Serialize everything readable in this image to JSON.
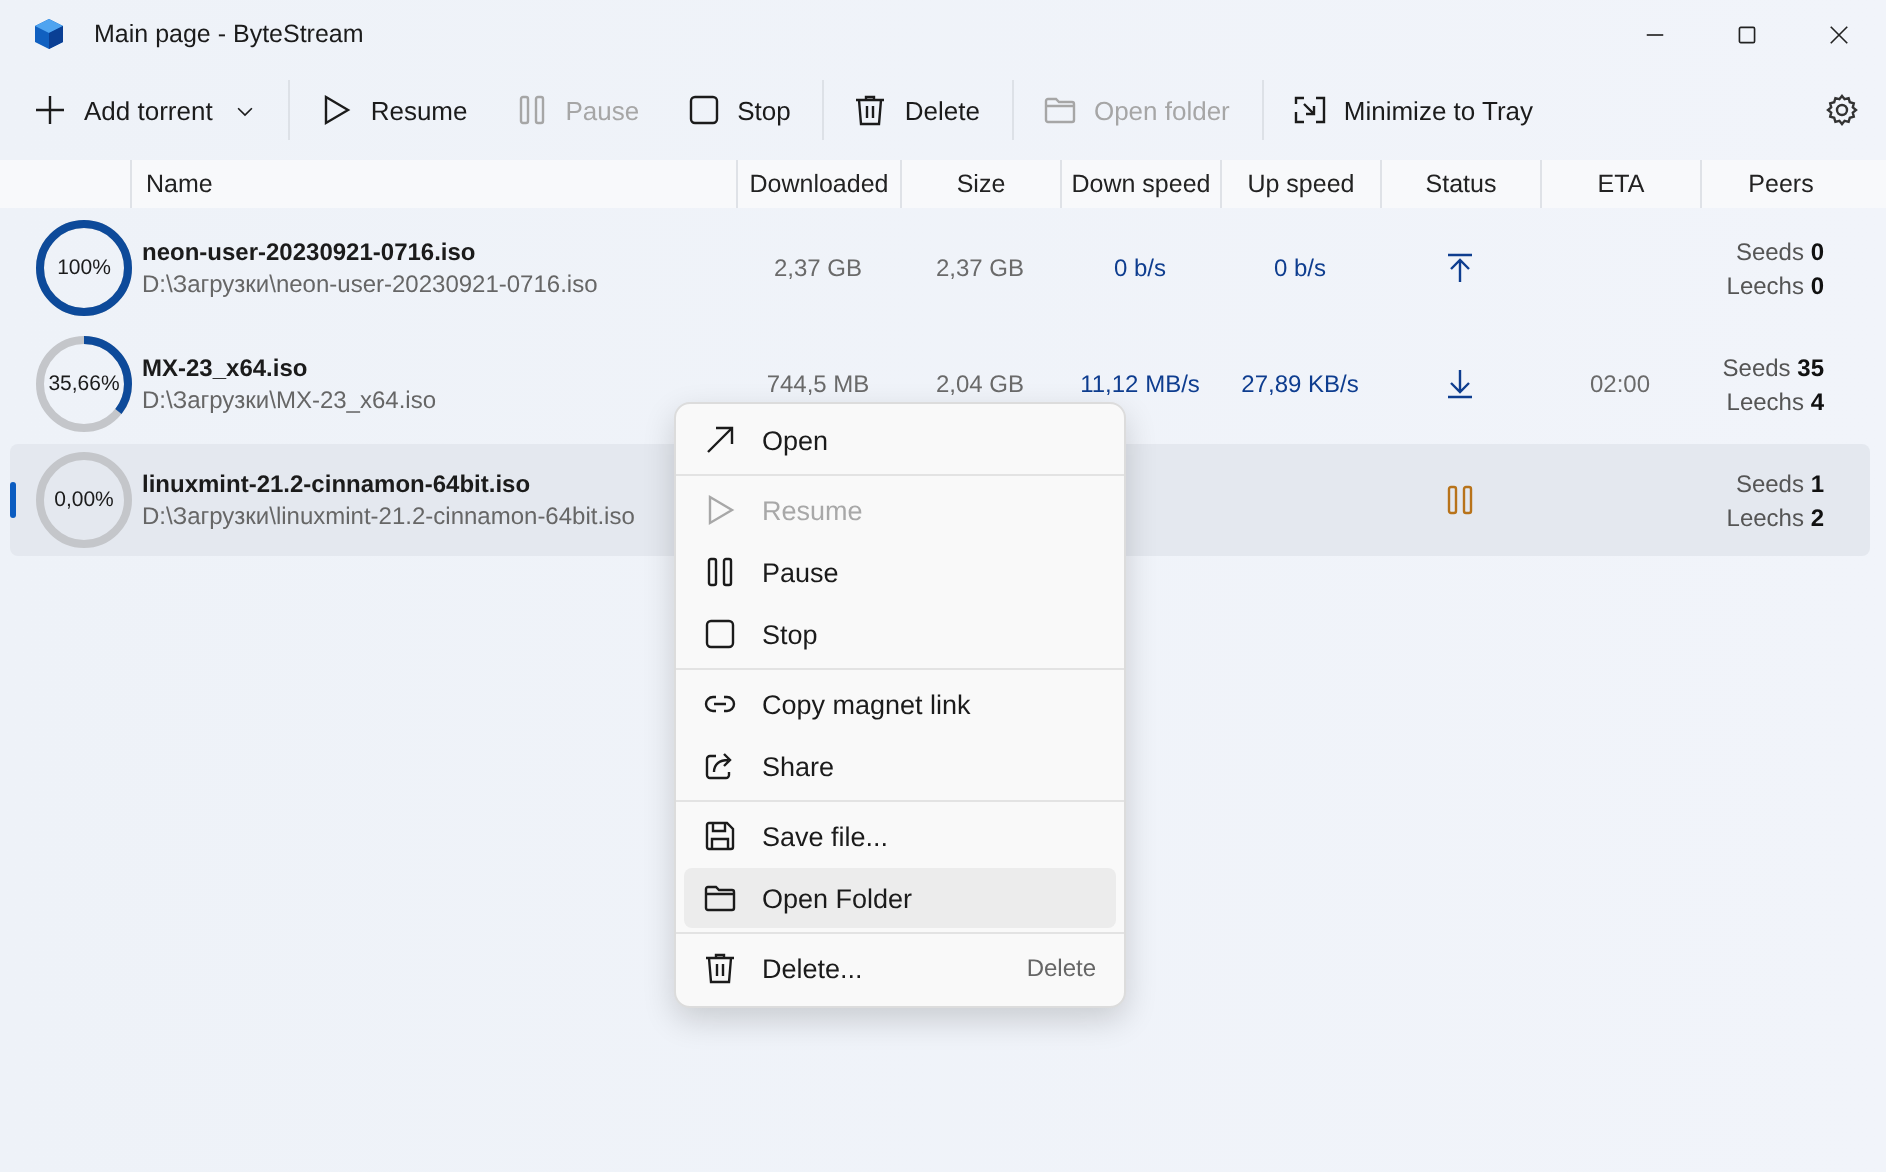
{
  "window": {
    "title": "Main page - ByteStream"
  },
  "toolbar": {
    "groups": [
      [
        {
          "label": "Add torrent",
          "disabled": false,
          "dropdown": true
        }
      ],
      [
        {
          "label": "Resume",
          "disabled": false,
          "dropdown": false
        },
        {
          "label": "Pause",
          "disabled": true,
          "dropdown": false
        },
        {
          "label": "Stop",
          "disabled": false,
          "dropdown": false
        }
      ],
      [
        {
          "label": "Delete",
          "disabled": false,
          "dropdown": false
        }
      ],
      [
        {
          "label": "Open folder",
          "disabled": true,
          "dropdown": false
        }
      ],
      [
        {
          "label": "Minimize to Tray",
          "disabled": false,
          "dropdown": false
        }
      ]
    ]
  },
  "table": {
    "columns": [
      "Name",
      "Downloaded",
      "Size",
      "Down speed",
      "Up speed",
      "Status",
      "ETA",
      "Peers"
    ],
    "rows": [
      {
        "progress": "100%",
        "level": 1,
        "name": "neon-user-20230921-0716.iso",
        "path": "D:\\Загрузки\\neon-user-20230921-0716.iso",
        "downloaded": "2,37 GB",
        "size": "2,37 GB",
        "down_speed": "0 b/s",
        "up_speed": "0 b/s",
        "status": {
          "kind": "seeding"
        },
        "seeds": "Seeds **0**",
        "leechs": "Leechs **0**",
        "selected": false
      },
      {
        "progress": "35,66%",
        "level": 0.3566,
        "name": "MX-23_x64.iso",
        "path": "D:\\Загрузки\\MX-23_x64.iso",
        "downloaded": "744,5 MB",
        "size": "2,04 GB",
        "down_speed": "11,12 MB/s",
        "up_speed": "27,89 KB/s",
        "status": {
          "kind": "downloading"
        },
        "eta": "02:00",
        "seeds": "Seeds **35**",
        "leechs": "Leechs **4**",
        "selected": false
      },
      {
        "progress": "0,00%",
        "level": 0,
        "name": "linuxmint-21.2-cinnamon-64bit.iso",
        "path": "D:\\Загрузки\\linuxmint-21.2-cinnamon-64bit.iso",
        "status": {
          "kind": "paused"
        },
        "seeds": "Seeds **1**",
        "leechs": "Leechs **2**",
        "selected": true
      }
    ]
  },
  "context_menu": {
    "groups": [
      [
        {
          "label": "Open",
          "disabled": false,
          "selected": false
        }
      ],
      [
        {
          "label": "Resume",
          "disabled": true,
          "selected": false
        },
        {
          "label": "Pause",
          "disabled": false,
          "selected": false
        },
        {
          "label": "Stop",
          "disabled": false,
          "selected": false
        }
      ],
      [
        {
          "label": "Copy magnet link",
          "disabled": false,
          "selected": false
        },
        {
          "label": "Share",
          "disabled": false,
          "selected": false
        }
      ],
      [
        {
          "label": "Save file...",
          "disabled": false,
          "selected": false
        },
        {
          "label": "Open Folder",
          "disabled": false,
          "selected": true
        }
      ],
      [
        {
          "label": "Delete...",
          "disabled": false,
          "selected": false,
          "shortcut": "Delete"
        }
      ]
    ]
  }
}
